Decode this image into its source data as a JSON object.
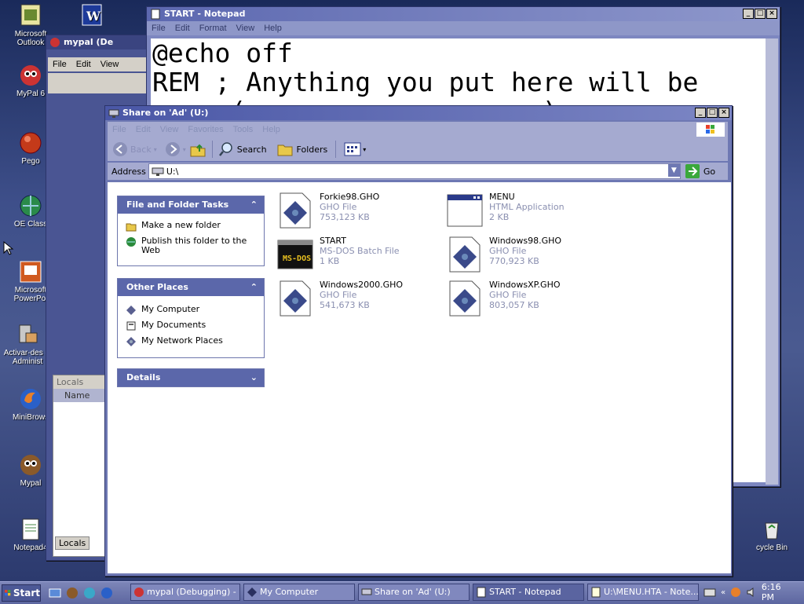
{
  "desktop": {
    "icons": [
      {
        "label": "Microsoft Outlook",
        "glyph": "outlook"
      },
      {
        "label": "MyPal 6",
        "glyph": "mypal"
      },
      {
        "label": "Pego",
        "glyph": "ball"
      },
      {
        "label": "OE Class",
        "glyph": "globe"
      },
      {
        "label": "Microsoft PowerPoi",
        "glyph": "powerpoint"
      },
      {
        "label": "Activar-des el Administ",
        "glyph": "admin"
      },
      {
        "label": "MiniBrows",
        "glyph": "firefox"
      },
      {
        "label": "Mypal",
        "glyph": "mypal"
      },
      {
        "label": "Notepad4",
        "glyph": "notepad"
      }
    ],
    "recycle_label": "cycle Bin"
  },
  "notepad": {
    "title": "START - Notepad",
    "menu": [
      "File",
      "Edit",
      "Format",
      "View",
      "Help"
    ],
    "lines": [
      "@echo off",
      "REM ; Anything you put here will be",
      "     (                   )"
    ]
  },
  "mypal_window": {
    "title": "mypal (De",
    "menu": [
      "File",
      "Edit",
      "View"
    ],
    "locals_header": "Locals",
    "name_col": "Name",
    "locals_tab": "Locals"
  },
  "explorer": {
    "title": "Share on 'Ad' (U:)",
    "menu": [
      "File",
      "Edit",
      "View",
      "Favorites",
      "Tools",
      "Help"
    ],
    "toolbar": {
      "back": "Back",
      "search": "Search",
      "folders": "Folders"
    },
    "address": {
      "label": "Address",
      "value": "U:\\",
      "go": "Go"
    },
    "panels": [
      {
        "title": "File and Folder Tasks",
        "chevron": "⌃",
        "items": [
          {
            "label": "Make a new folder",
            "icon": "new-folder-icon"
          },
          {
            "label": "Publish this folder to the Web",
            "icon": "publish-web-icon"
          }
        ]
      },
      {
        "title": "Other Places",
        "chevron": "⌃",
        "items": [
          {
            "label": "My Computer",
            "icon": "my-computer-icon"
          },
          {
            "label": "My Documents",
            "icon": "my-documents-icon"
          },
          {
            "label": "My Network Places",
            "icon": "network-places-icon"
          }
        ]
      },
      {
        "title": "Details",
        "chevron": "⌄",
        "items": []
      }
    ],
    "files": [
      {
        "name": "Forkie98.GHO",
        "type": "GHO File",
        "size": "753,123 KB",
        "icon": "gho-icon"
      },
      {
        "name": "MENU",
        "type": "HTML Application",
        "size": "2 KB",
        "icon": "hta-icon"
      },
      {
        "name": "START",
        "type": "MS-DOS Batch File",
        "size": "1 KB",
        "icon": "batch-icon"
      },
      {
        "name": "Windows98.GHO",
        "type": "GHO File",
        "size": "770,923 KB",
        "icon": "gho-icon"
      },
      {
        "name": "Windows2000.GHO",
        "type": "GHO File",
        "size": "541,673 KB",
        "icon": "gho-icon"
      },
      {
        "name": "WindowsXP.GHO",
        "type": "GHO File",
        "size": "803,057 KB",
        "icon": "gho-icon"
      }
    ]
  },
  "taskbar": {
    "start": "Start",
    "buttons": [
      {
        "label": "mypal (Debugging) - ...",
        "icon": "mypal"
      },
      {
        "label": "My Computer",
        "icon": "computer"
      },
      {
        "label": "Share on 'Ad' (U:)",
        "icon": "share"
      },
      {
        "label": "START - Notepad",
        "icon": "notepad"
      },
      {
        "label": "U:\\MENU.HTA - Note...",
        "icon": "notepad"
      }
    ],
    "clock": "6:16 PM"
  }
}
